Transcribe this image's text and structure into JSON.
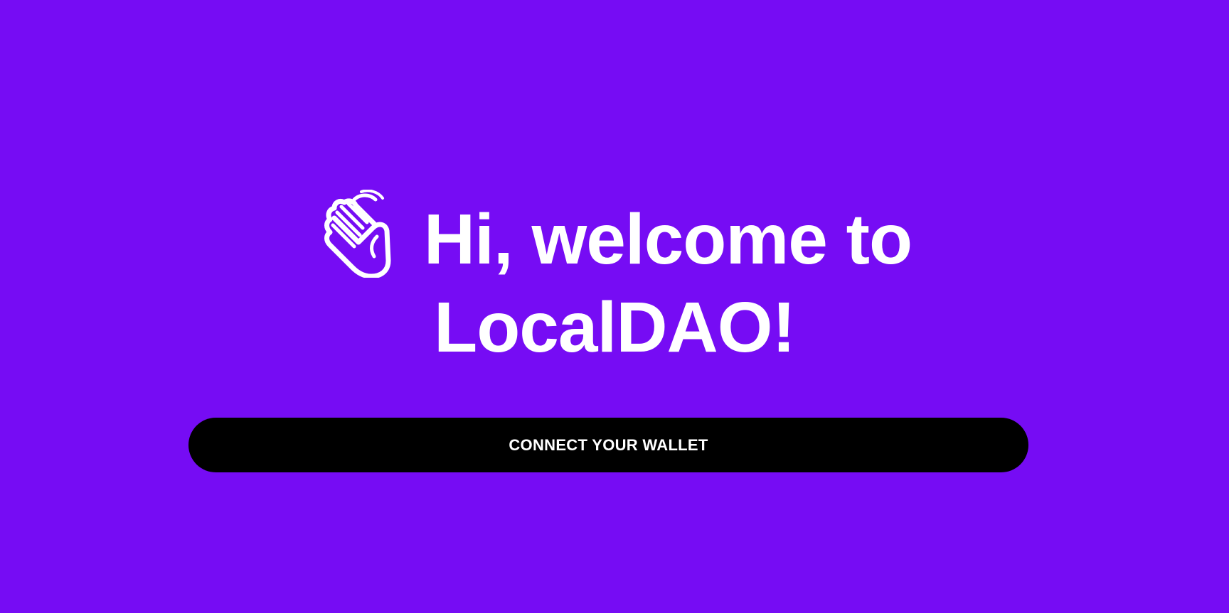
{
  "welcome": {
    "icon": "waving-hand-icon",
    "line1": "Hi, welcome to",
    "line2": "LocalDAO!"
  },
  "connect_button": {
    "label": "CONNECT YOUR WALLET"
  },
  "colors": {
    "background": "#760cf4",
    "button_background": "#000000",
    "text": "#ffffff"
  }
}
